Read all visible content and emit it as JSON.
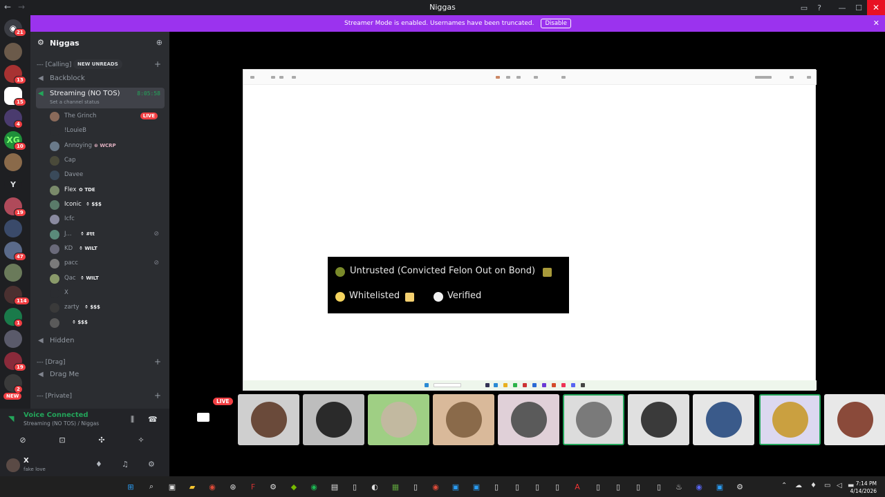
{
  "window": {
    "title": "Niggas",
    "back": "←",
    "forward": "→"
  },
  "banner": {
    "text": "Streamer Mode is enabled. Usernames have been truncated.",
    "button": "Disable",
    "close": "✕"
  },
  "server": {
    "name": "Niggas"
  },
  "guild_badges": [
    "21",
    "13",
    "15",
    "4",
    "10",
    "19",
    "47",
    "114",
    "1",
    "19",
    "2"
  ],
  "guild_y": "Y",
  "guild_new": "NEW",
  "categories": {
    "calling": "--- [Calling]",
    "drag": "--- [Drag]",
    "private": "--- [Private]"
  },
  "new_unreads": "NEW UNREADS",
  "channels": {
    "backblock": "Backblock",
    "streaming": "Streaming (NO TOS)",
    "streaming_time": "8:05:58",
    "streaming_status": "Set a channel status",
    "hidden": "Hidden",
    "drag_me": "Drag Me"
  },
  "members": [
    {
      "name": "The Grinch",
      "tag": "",
      "live": "LIVE"
    },
    {
      "name": "!LouieB",
      "tag": ""
    },
    {
      "name": "Annoying",
      "tag": "WCRP"
    },
    {
      "name": "Cap",
      "tag": ""
    },
    {
      "name": "Davee",
      "tag": ""
    },
    {
      "name": "Flex",
      "tag": "TDE"
    },
    {
      "name": "Iconic",
      "tag": "$$$"
    },
    {
      "name": "Icfc",
      "tag": ""
    },
    {
      "name": "J...",
      "tag": "#tt"
    },
    {
      "name": "KD",
      "tag": "WILT"
    },
    {
      "name": "pacc",
      "tag": ""
    },
    {
      "name": "Qac",
      "tag": "WILT"
    },
    {
      "name": "X",
      "tag": ""
    },
    {
      "name": "zarty",
      "tag": "$$$"
    },
    {
      "name": "",
      "tag": "$$$"
    }
  ],
  "voice": {
    "title": "Voice Connected",
    "sub": "Streaming (NO TOS) / Niggas"
  },
  "user": {
    "name": "X",
    "status": "fake love"
  },
  "legend": {
    "untrusted": "Untrusted (Convicted Felon Out on Bond)",
    "whitelisted": "Whitelisted",
    "verified": "Verified",
    "colors": {
      "untrusted": "#7a8a2a",
      "whitelisted": "#f4d35e",
      "verified": "#f2f2f2"
    }
  },
  "tiles": {
    "live": "LIVE"
  },
  "clock": {
    "time": "7:14 PM",
    "date": "4/14/2026"
  }
}
